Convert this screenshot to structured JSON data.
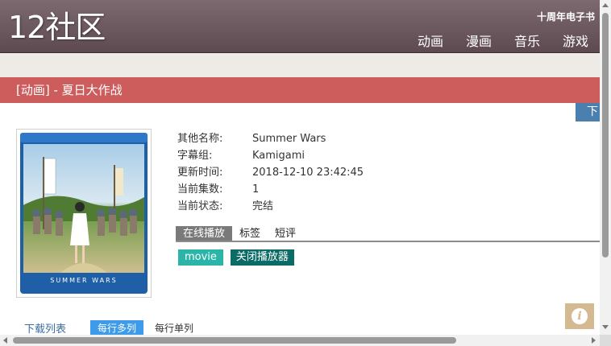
{
  "header": {
    "logo": "12社区",
    "promo": "十周年电子书",
    "nav": [
      "动画",
      "漫画",
      "音乐",
      "游戏"
    ]
  },
  "page_title": "[动画] - 夏日大作战",
  "download_tab": "下",
  "poster": {
    "caption": "SUMMER WARS"
  },
  "info": [
    {
      "key": "其他名称:",
      "value": "Summer Wars"
    },
    {
      "key": "字幕组:",
      "value": "Kamigami"
    },
    {
      "key": "更新时间:",
      "value": "2018-12-10 23:42:45"
    },
    {
      "key": "当前集数:",
      "value": "1"
    },
    {
      "key": "当前状态:",
      "value": "完结"
    }
  ],
  "tabs": [
    "在线播放",
    "标签",
    "短评"
  ],
  "player": {
    "movie_label": "movie",
    "close_label": "关闭播放器"
  },
  "download_list": {
    "title": "下载列表",
    "multi_label": "每行多列",
    "single_label": "每行单列"
  },
  "colors": {
    "header": "#6d5a60",
    "title_bar": "#cd5c5c",
    "movie_button": "#2ab5a8",
    "close_button": "#0b6b66",
    "multi_button": "#3d9be9",
    "info_button": "#d5b990"
  },
  "icons": {
    "info_button": "info-icon"
  }
}
